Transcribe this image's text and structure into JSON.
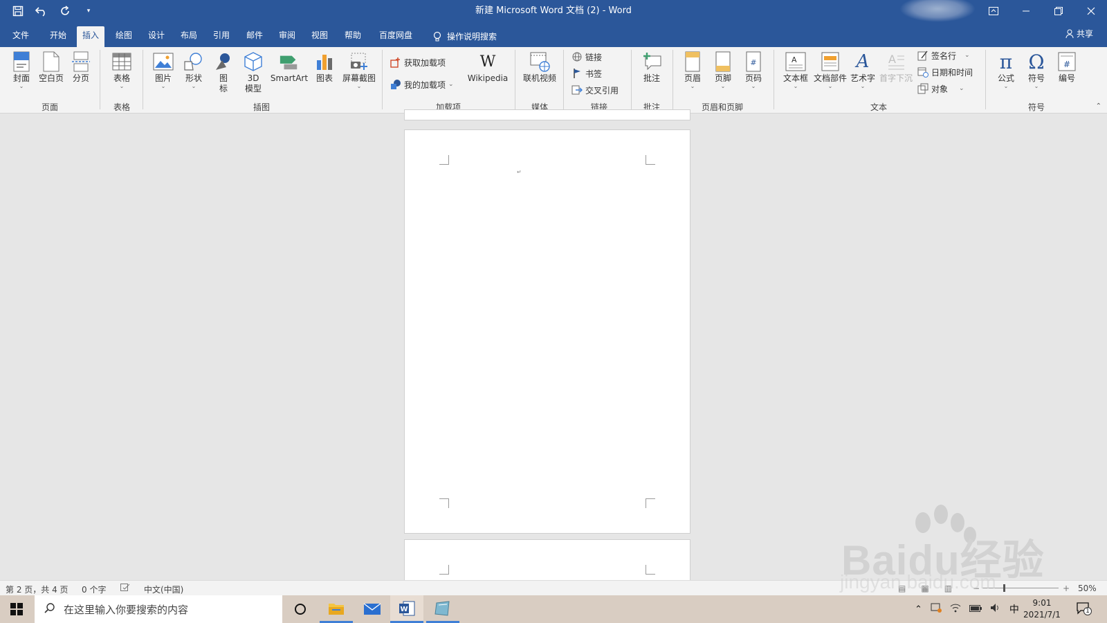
{
  "window": {
    "title": "新建 Microsoft Word 文档 (2)  -  Word"
  },
  "tabs": [
    "文件",
    "开始",
    "插入",
    "绘图",
    "设计",
    "布局",
    "引用",
    "邮件",
    "审阅",
    "视图",
    "帮助",
    "百度网盘",
    "操作说明搜索"
  ],
  "share": "共享",
  "ribbon": {
    "pages": {
      "cover": "封面",
      "blank": "空白页",
      "break": "分页",
      "group": "页面"
    },
    "tables": {
      "table": "表格",
      "group": "表格"
    },
    "illustrations": {
      "picture": "图片",
      "shapes": "形状",
      "icons_1": "图",
      "icons_2": "标",
      "model_1": "3D",
      "model_2": "模型",
      "smartart": "SmartArt",
      "chart": "图表",
      "screenshot": "屏幕截图",
      "group": "插图"
    },
    "addins": {
      "get": "获取加载项",
      "mine": "我的加载项",
      "wikipedia": "Wikipedia",
      "group": "加载项"
    },
    "media": {
      "video": "联机视频",
      "group": "媒体"
    },
    "links": {
      "link": "链接",
      "bookmark": "书签",
      "crossref": "交叉引用",
      "group": "链接"
    },
    "comments": {
      "comment": "批注",
      "group": "批注"
    },
    "headerfooter": {
      "header": "页眉",
      "footer": "页脚",
      "pagenum": "页码",
      "group": "页眉和页脚"
    },
    "text": {
      "textbox": "文本框",
      "quickparts": "文档部件",
      "wordart": "艺术字",
      "dropcap": "首字下沉",
      "signature": "签名行",
      "datetime": "日期和时间",
      "object": "对象",
      "group": "文本"
    },
    "symbols": {
      "equation": "公式",
      "symbol": "符号",
      "number": "编号",
      "group": "符号"
    }
  },
  "status": {
    "page": "第 2 页，共 4 页",
    "words": "0 个字",
    "lang": "中文(中国)",
    "zoom": "50%"
  },
  "taskbar": {
    "search_placeholder": "在这里输入你要搜索的内容",
    "time": "9:01",
    "date": "2021/7/1",
    "ime": "中",
    "notif": "1"
  },
  "watermark": {
    "brand": "Baidu经验",
    "url": "jingyan.baidu.com"
  },
  "colors": {
    "word_blue": "#2b579a",
    "ribbon_bg": "#f3f3f3",
    "canvas": "#e6e6e6"
  }
}
